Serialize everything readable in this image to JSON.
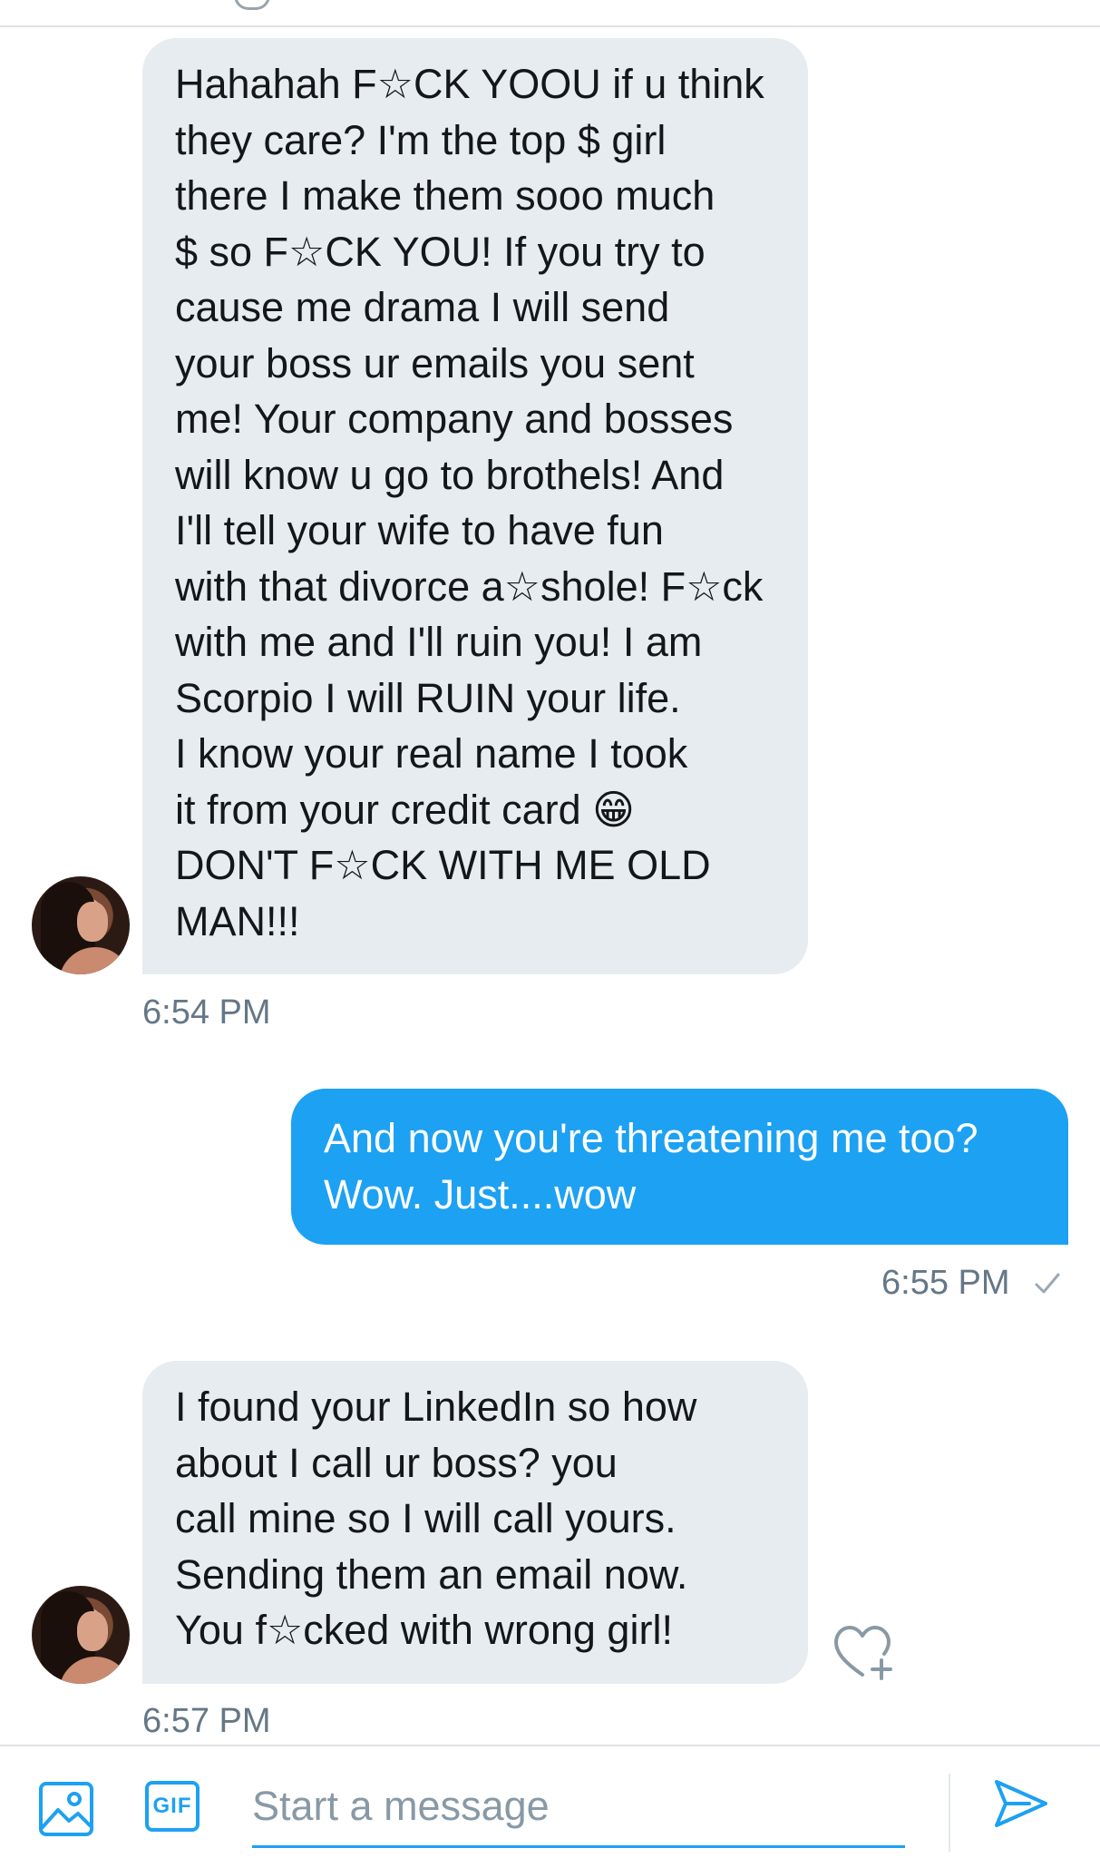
{
  "conversation": {
    "messages": [
      {
        "direction": "received",
        "text": "Hahahah F☆CK YOOU if u think\nthey care? I'm the top $ girl\nthere I make them sooo much\n$ so F☆CK YOU! If you try to\ncause me drama I will send\nyour boss ur emails you sent\nme! Your company and bosses\nwill know u go to brothels! And\nI'll tell your wife to have fun\nwith that divorce a☆shole!  F☆ck\nwith me and I'll ruin you!  I am\nScorpio I will RUIN your life.\nI know your real name I took\nit from your credit card  😁\nDON'T F☆CK WITH ME OLD\nMAN!!!",
        "time": "6:54 PM"
      },
      {
        "direction": "sent",
        "text": "And now you're threatening me too?\nWow. Just....wow",
        "time": "6:55 PM"
      },
      {
        "direction": "received",
        "text": "I found your LinkedIn so how\nabout I call ur boss? you\ncall mine so I will call yours.\nSending them an email now.\nYou f☆cked with wrong girl!",
        "time": "6:57 PM"
      }
    ]
  },
  "composer": {
    "placeholder": "Start a message",
    "gif_label": "GIF"
  },
  "colors": {
    "accent": "#1da1f2",
    "received_bubble": "#e6ecf0",
    "timestamp": "#657786"
  },
  "icons": [
    "media-icon",
    "gif-icon",
    "send-icon",
    "read-check-icon",
    "add-reaction-heart-icon"
  ]
}
